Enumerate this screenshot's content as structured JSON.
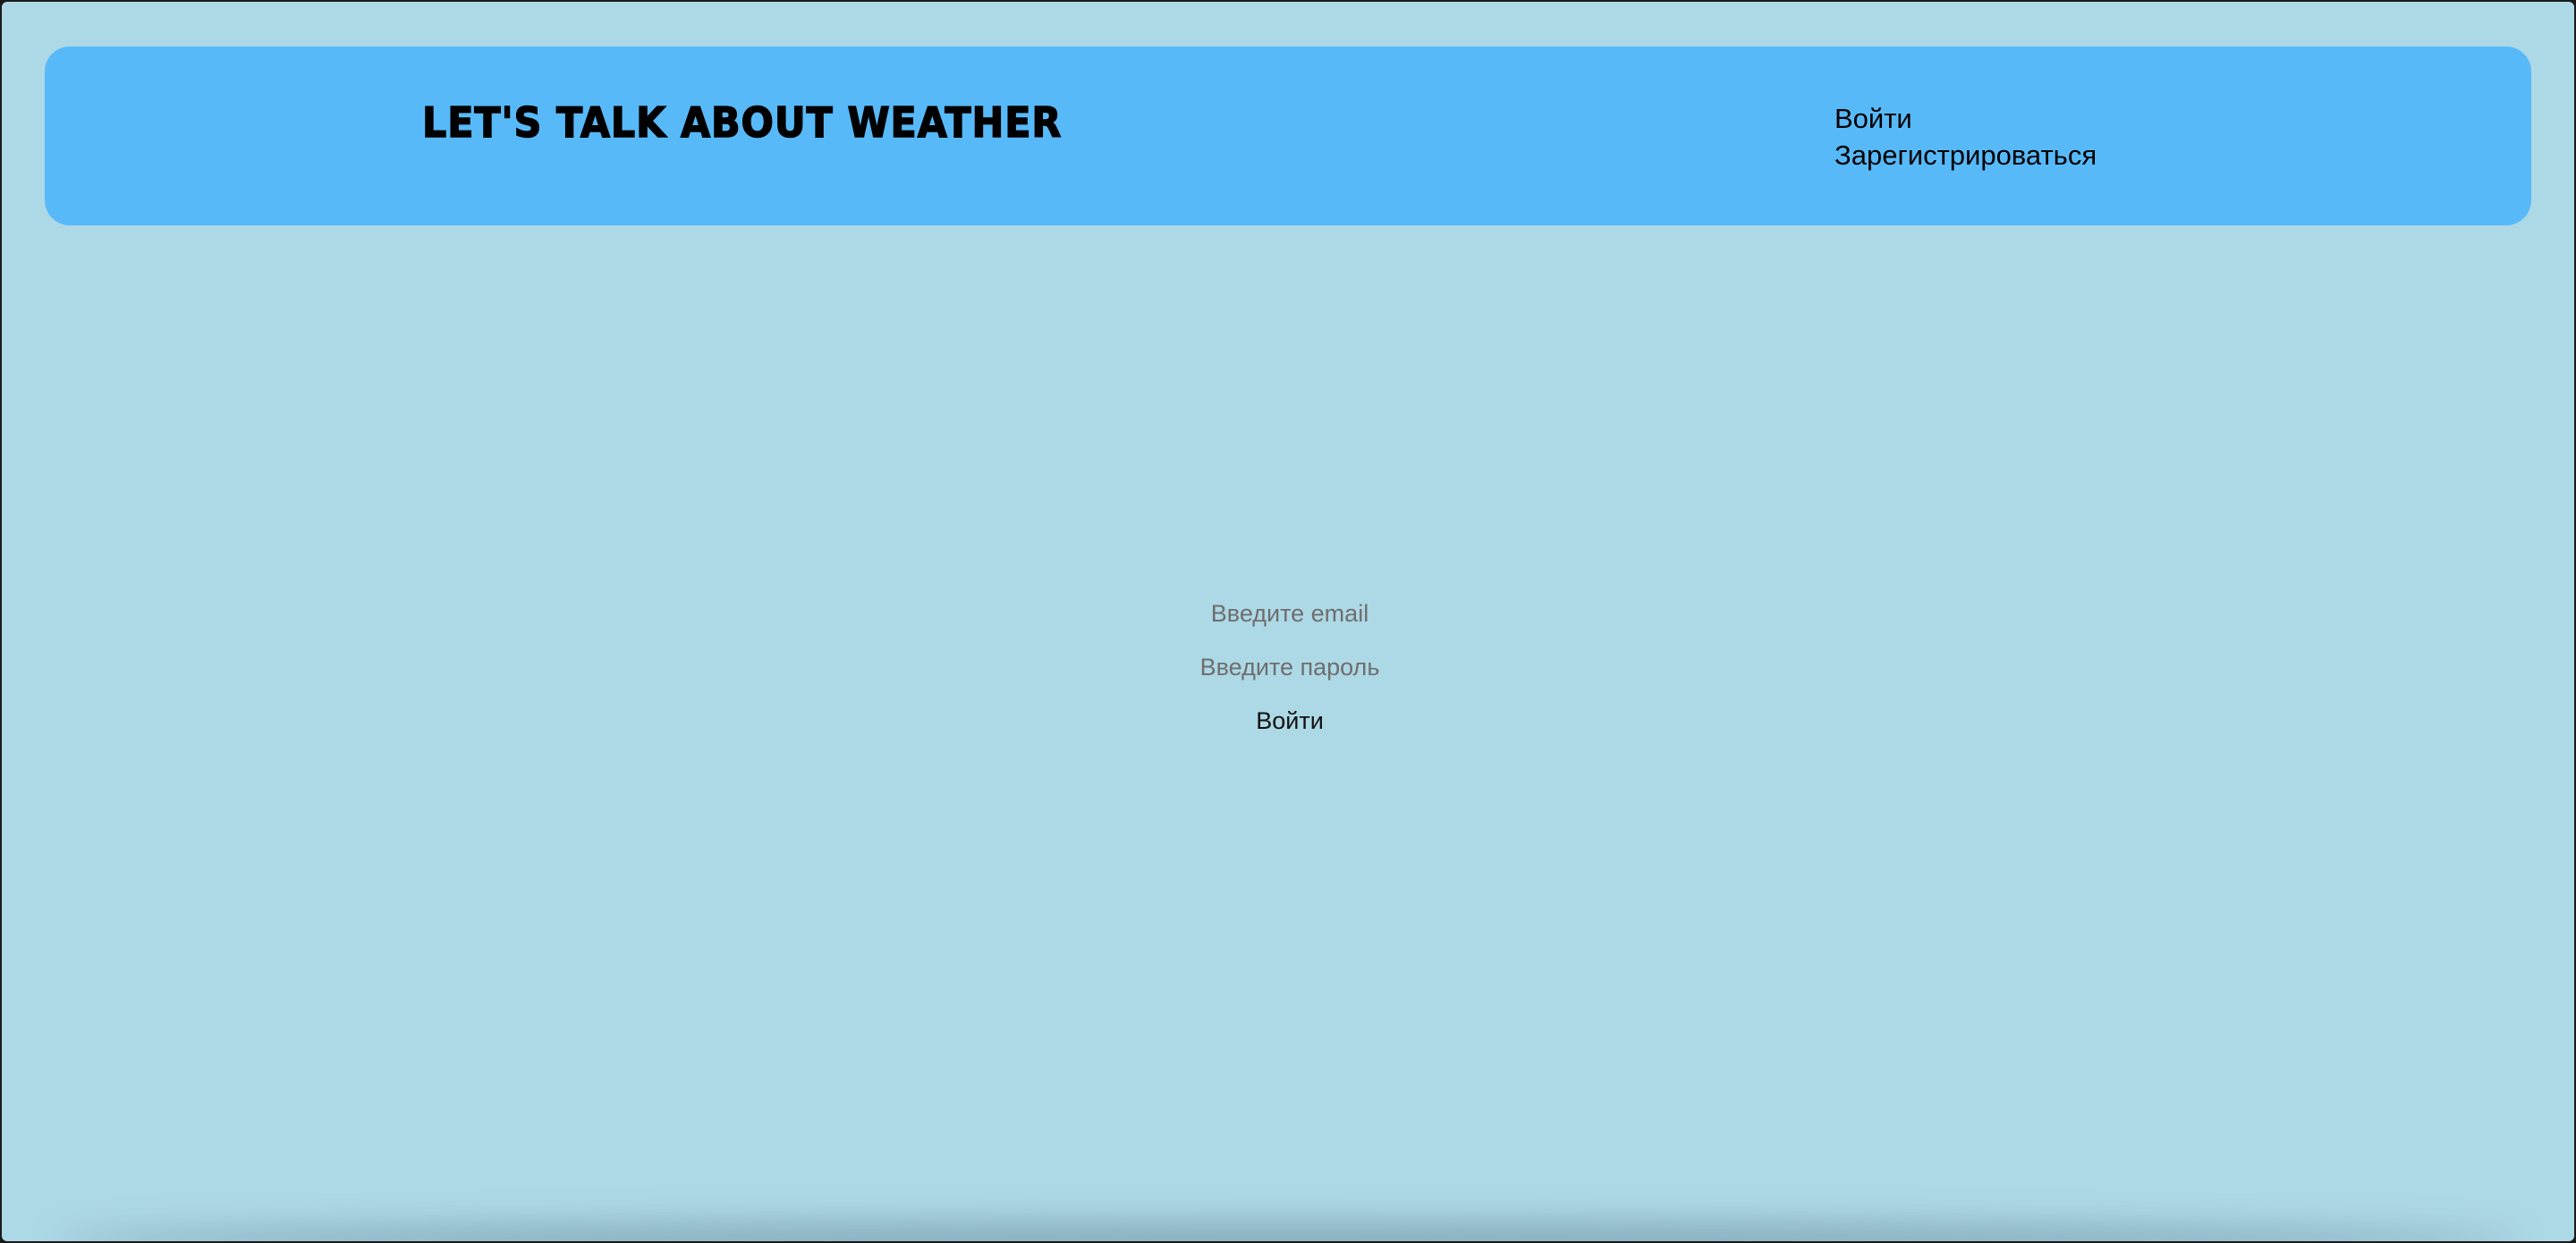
{
  "header": {
    "title": "Let's talk about weather",
    "nav": {
      "login_label": "Войти",
      "register_label": "Зарегистрироваться"
    }
  },
  "login_form": {
    "email_placeholder": "Введите email",
    "password_placeholder": "Введите пароль",
    "submit_label": "Войти"
  },
  "colors": {
    "page_background": "#add8e6",
    "header_background": "#57b9f8"
  }
}
